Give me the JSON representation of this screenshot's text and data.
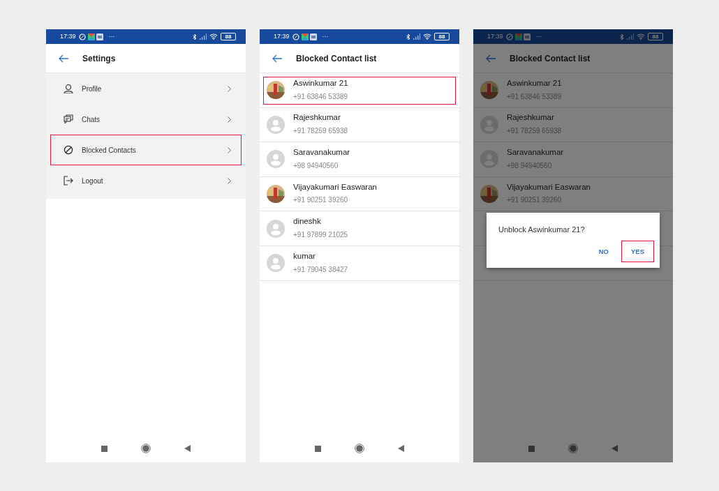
{
  "screens": [
    {
      "kind": "settings",
      "dimmed": false,
      "status_bar": {
        "time": "17:39",
        "more": "···",
        "battery": "88"
      },
      "title": "Settings",
      "items": [
        {
          "label": "Profile",
          "highlighted": false
        },
        {
          "label": "Chats",
          "highlighted": false
        },
        {
          "label": "Blocked Contacts",
          "highlighted": true
        },
        {
          "label": "Logout",
          "highlighted": false
        }
      ]
    },
    {
      "kind": "contacts",
      "dimmed": false,
      "status_bar": {
        "time": "17:39",
        "more": "···",
        "battery": "88"
      },
      "title": "Blocked Contact list",
      "contacts": [
        {
          "name": "Aswinkumar 21",
          "phone": "+91 63846 53389",
          "kind": "picture",
          "highlighted": true
        },
        {
          "name": "Rajeshkumar",
          "phone": "+91 78259 65938",
          "kind": "placeholder",
          "highlighted": false
        },
        {
          "name": "Saravanakumar",
          "phone": "+98 94940560",
          "kind": "placeholder",
          "highlighted": false
        },
        {
          "name": "Vijayakumari Easwaran",
          "phone": "+91 90251 39260",
          "kind": "picture",
          "highlighted": false
        },
        {
          "name": "dineshk",
          "phone": "+91 97899 21025",
          "kind": "placeholder",
          "highlighted": false
        },
        {
          "name": "kumar",
          "phone": "+91 79045 38427",
          "kind": "placeholder",
          "highlighted": false
        }
      ]
    },
    {
      "kind": "contacts",
      "dimmed": true,
      "status_bar": {
        "time": "17:39",
        "more": "···",
        "battery": "88"
      },
      "title": "Blocked Contact list",
      "contacts": [
        {
          "name": "Aswinkumar 21",
          "phone": "+91 63846 53389",
          "kind": "picture",
          "highlighted": false
        },
        {
          "name": "Rajeshkumar",
          "phone": "+91 78259 65938",
          "kind": "placeholder",
          "highlighted": false
        },
        {
          "name": "Saravanakumar",
          "phone": "+98 94940560",
          "kind": "placeholder",
          "highlighted": false
        },
        {
          "name": "Vijayakumari Easwaran",
          "phone": "+91 90251 39260",
          "kind": "picture",
          "highlighted": false
        }
      ],
      "dialog": {
        "message": "Unblock Aswinkumar 21?",
        "buttons": [
          {
            "label": "NO",
            "highlighted": false
          },
          {
            "label": "YES",
            "highlighted": true
          }
        ]
      }
    }
  ]
}
